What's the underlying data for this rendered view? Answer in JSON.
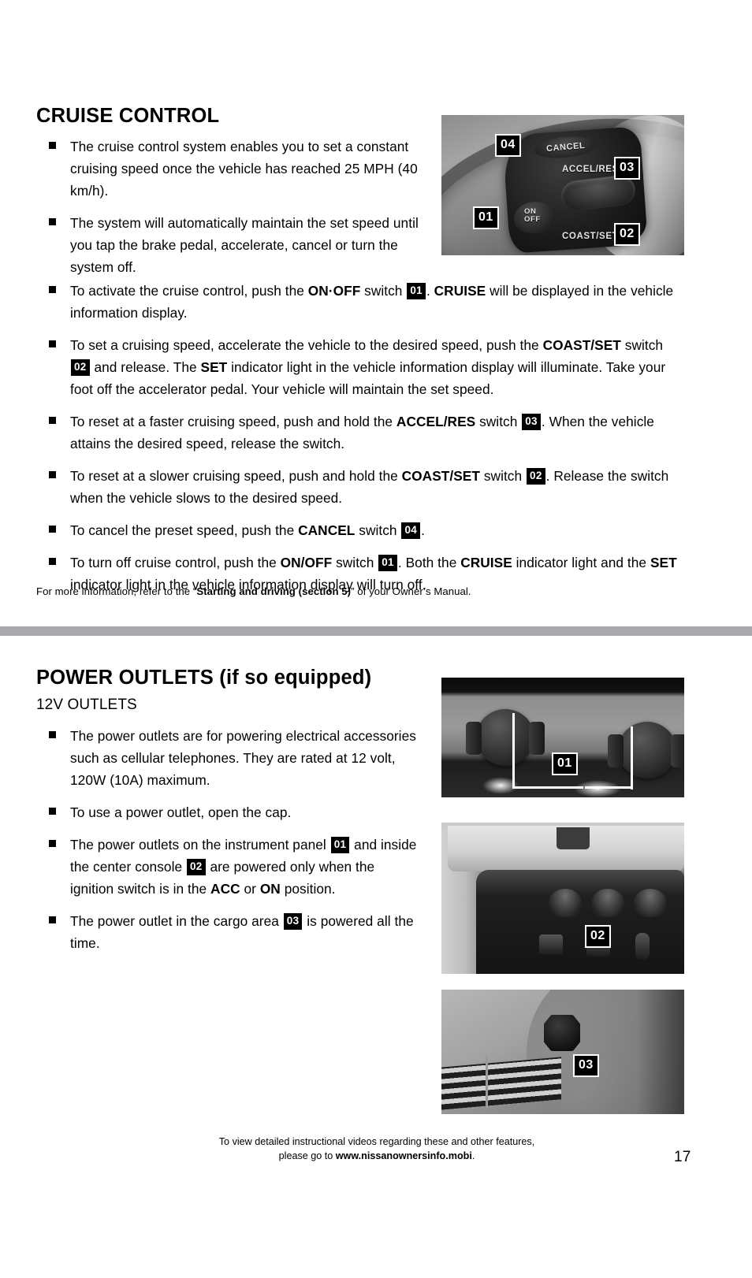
{
  "page": {
    "number": "17",
    "divider_color": "#a7a9ac"
  },
  "cruise_control": {
    "title": "CRUISE CONTROL",
    "bullets": [
      {
        "id": "cc-bullet-1",
        "segments": [
          {
            "type": "text",
            "value": "The cruise control system enables you to set a constant cruising speed once the vehicle has reached 25 MPH (40 km/h)."
          }
        ]
      },
      {
        "id": "cc-bullet-2",
        "segments": [
          {
            "type": "text",
            "value": "The system will automatically maintain the set speed until you tap the brake pedal, accelerate, cancel or turn the system off."
          }
        ]
      },
      {
        "id": "cc-bullet-3",
        "segments": [
          {
            "type": "text",
            "value": "To activate the cruise control, push the "
          },
          {
            "type": "bold",
            "value": "ON·OFF"
          },
          {
            "type": "text",
            "value": " switch "
          },
          {
            "type": "chip",
            "value": "01"
          },
          {
            "type": "text",
            "value": ". "
          },
          {
            "type": "bold",
            "value": "CRUISE"
          },
          {
            "type": "text",
            "value": " will be displayed in the vehicle information display."
          }
        ]
      },
      {
        "id": "cc-bullet-4",
        "segments": [
          {
            "type": "text",
            "value": "To set a cruising speed, accelerate the vehicle to the desired speed, push the "
          },
          {
            "type": "bold",
            "value": "COAST/SET"
          },
          {
            "type": "text",
            "value": " switch "
          },
          {
            "type": "chip",
            "value": "02"
          },
          {
            "type": "text",
            "value": " and release. The "
          },
          {
            "type": "bold",
            "value": "SET"
          },
          {
            "type": "text",
            "value": " indicator light in the vehicle information display will illuminate. Take your foot off the accelerator pedal. Your vehicle will maintain the set speed."
          }
        ]
      },
      {
        "id": "cc-bullet-5",
        "segments": [
          {
            "type": "text",
            "value": "To reset at a faster cruising speed, push and hold the "
          },
          {
            "type": "bold",
            "value": "ACCEL/RES"
          },
          {
            "type": "text",
            "value": " switch "
          },
          {
            "type": "chip",
            "value": "03"
          },
          {
            "type": "text",
            "value": ". When the vehicle attains the desired speed, release the switch."
          }
        ]
      },
      {
        "id": "cc-bullet-6",
        "segments": [
          {
            "type": "text",
            "value": "To reset at a slower cruising speed, push and hold the "
          },
          {
            "type": "bold",
            "value": "COAST/SET"
          },
          {
            "type": "text",
            "value": " switch "
          },
          {
            "type": "chip",
            "value": "02"
          },
          {
            "type": "text",
            "value": ". Release the switch when the vehicle slows to the desired speed."
          }
        ]
      },
      {
        "id": "cc-bullet-7",
        "segments": [
          {
            "type": "text",
            "value": "To cancel the preset speed, push the "
          },
          {
            "type": "bold",
            "value": "CANCEL"
          },
          {
            "type": "text",
            "value": " switch "
          },
          {
            "type": "chip",
            "value": "04"
          },
          {
            "type": "text",
            "value": "."
          }
        ]
      },
      {
        "id": "cc-bullet-8",
        "segments": [
          {
            "type": "text",
            "value": "To turn off cruise control, push the "
          },
          {
            "type": "bold",
            "value": "ON/OFF"
          },
          {
            "type": "text",
            "value": " switch "
          },
          {
            "type": "chip",
            "value": "01"
          },
          {
            "type": "text",
            "value": ". Both the "
          },
          {
            "type": "bold",
            "value": "CRUISE"
          },
          {
            "type": "text",
            "value": " indicator light and the "
          },
          {
            "type": "bold",
            "value": "SET"
          },
          {
            "type": "text",
            "value": " indicator light in the vehicle information display will turn off."
          }
        ]
      }
    ],
    "footnote": [
      {
        "type": "text",
        "value": "For more information, refer to the “"
      },
      {
        "type": "bold",
        "value": "Starting and driving (section 5)"
      },
      {
        "type": "text",
        "value": "” of your Owner’s Manual."
      }
    ],
    "photo": {
      "name": "steering-wheel-cruise-switches-photo",
      "labels": [
        {
          "text": "CANCEL"
        },
        {
          "text": "ACCEL/RES"
        },
        {
          "text": "ON\nOFF"
        },
        {
          "text": "COAST/SET"
        }
      ],
      "callouts": [
        "04",
        "03",
        "01",
        "02"
      ]
    }
  },
  "power_outlets": {
    "title": "POWER OUTLETS (if so equipped)",
    "subtitle": "12V OUTLETS",
    "bullets": [
      {
        "id": "po-bullet-1",
        "segments": [
          {
            "type": "text",
            "value": "The power outlets are for powering electrical accessories such as cellular telephones. They are rated at 12 volt, 120W (10A) maximum."
          }
        ]
      },
      {
        "id": "po-bullet-2",
        "segments": [
          {
            "type": "text",
            "value": "To use a power outlet, open the cap."
          }
        ]
      },
      {
        "id": "po-bullet-3",
        "segments": [
          {
            "type": "text",
            "value": "The power outlets on the instrument panel "
          },
          {
            "type": "chip",
            "value": "01"
          },
          {
            "type": "text",
            "value": " and inside the center console "
          },
          {
            "type": "chip",
            "value": "02"
          },
          {
            "type": "text",
            "value": " are powered only when the ignition switch is in the "
          },
          {
            "type": "bold",
            "value": "ACC"
          },
          {
            "type": "text",
            "value": " or "
          },
          {
            "type": "bold",
            "value": "ON"
          },
          {
            "type": "text",
            "value": " position."
          }
        ]
      },
      {
        "id": "po-bullet-4",
        "segments": [
          {
            "type": "text",
            "value": "The power outlet in the cargo area "
          },
          {
            "type": "chip",
            "value": "03"
          },
          {
            "type": "text",
            "value": " is powered all the time."
          }
        ]
      }
    ],
    "photos": [
      {
        "name": "instrument-panel-outlets-photo",
        "callout": "01"
      },
      {
        "name": "center-console-outlet-photo",
        "callout": "02"
      },
      {
        "name": "cargo-area-outlet-photo",
        "callout": "03"
      }
    ]
  },
  "footer": {
    "line1": "To view detailed instructional videos regarding these and other features,",
    "line2_prefix": "please go to ",
    "line2_url": "www.nissanownersinfo.mobi",
    "line2_suffix": "."
  }
}
